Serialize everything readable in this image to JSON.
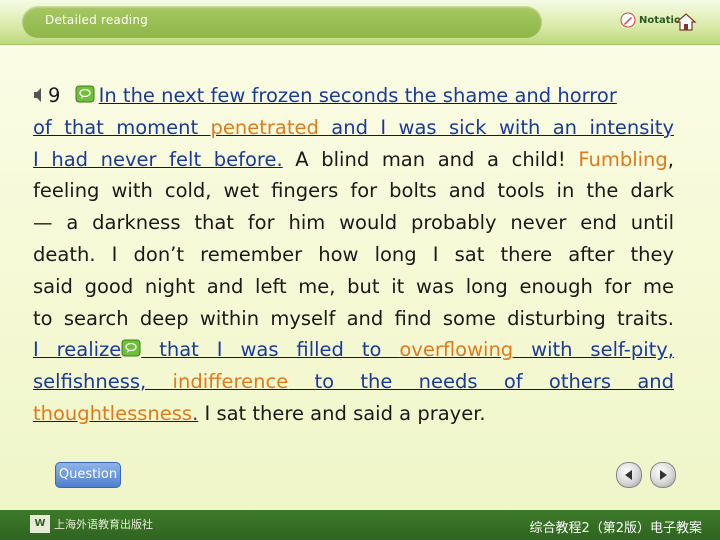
{
  "header": {
    "section_title": "Detailed reading",
    "notation_label": "Notation",
    "home_icon": "home-icon",
    "pencil_icon": "pencil-icon"
  },
  "paragraph": {
    "number": "9",
    "lines": [
      [
        {
          "t": "In the next few frozen seconds the shame and horror",
          "s": "u"
        }
      ],
      [
        {
          "t": "of that moment ",
          "s": "u"
        },
        {
          "t": "penetrated",
          "s": "uo"
        },
        {
          "t": " and I was sick with an intensity",
          "s": "u"
        }
      ],
      [
        {
          "t": "I had never felt before.",
          "s": "u"
        },
        {
          "t": " A blind man and a child! ",
          "s": ""
        },
        {
          "t": "Fumbling",
          "s": "o"
        },
        {
          "t": ",",
          "s": ""
        }
      ],
      [
        {
          "t": "feeling with cold, wet fingers for bolts and tools in the dark",
          "s": ""
        }
      ],
      [
        {
          "t": "— a darkness that for him would probably never end until",
          "s": ""
        }
      ],
      [
        {
          "t": "death. I don’t remember how long I sat there after they",
          "s": ""
        }
      ],
      [
        {
          "t": "said good night and left me, but it was long enough for me",
          "s": ""
        }
      ],
      [
        {
          "t": "to search deep within myself and find some disturbing traits.",
          "s": ""
        }
      ],
      [
        {
          "t": "I realize",
          "s": "u"
        },
        {
          "t": "BUBBLE",
          "s": "icon"
        },
        {
          "t": " that I was filled to ",
          "s": "u"
        },
        {
          "t": "overflowing",
          "s": "uo"
        },
        {
          "t": " with self-pity,",
          "s": "u"
        }
      ],
      [
        {
          "t": "selfishness, ",
          "s": "u"
        },
        {
          "t": "indifference",
          "s": "uo"
        },
        {
          "t": " to the needs of others and",
          "s": "u"
        }
      ],
      [
        {
          "t": "thoughtlessness",
          "s": "uo"
        },
        {
          "t": ".",
          "s": "u"
        },
        {
          "t": " I sat there and said a prayer.",
          "s": ""
        }
      ]
    ]
  },
  "controls": {
    "question_label": "Question",
    "prev_icon": "triangle-left-icon",
    "next_icon": "triangle-right-icon"
  },
  "footer": {
    "publisher": "上海外语教育出版社",
    "publisher_logo": "W",
    "book_title": "综合教程2（第2版）电子教案"
  },
  "colors": {
    "highlight": "#e07a1c",
    "link_text": "#1a3a9b",
    "footer_bg": "#2e6420"
  }
}
